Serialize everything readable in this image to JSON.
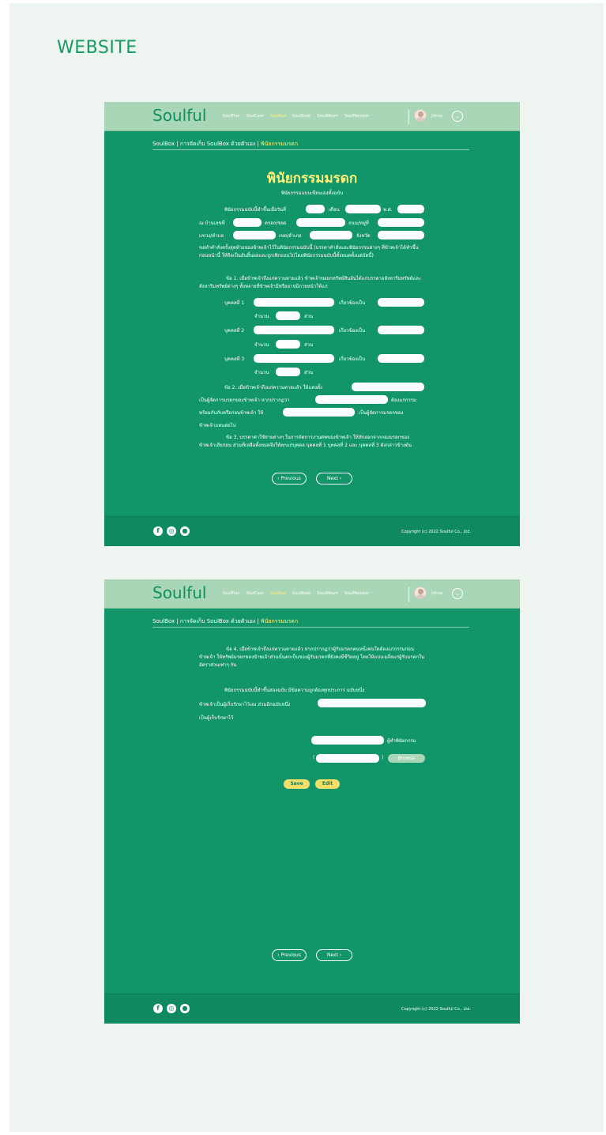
{
  "section_label": "WEBSITE",
  "nav": {
    "logo": "Soulful",
    "links": [
      "SoulPlan",
      "SoulCare",
      "SoulBox",
      "SoulBook",
      "SoulAlbum",
      "SoulMember"
    ],
    "active_link": "SoulBox",
    "user_name": "Jirime",
    "chevron": "⌄"
  },
  "breadcrumb": {
    "path": "SoulBox | การจัดเก็บ SoulBox ด้วยตัวเอง | ",
    "current": "พินัยกรรมมรดก"
  },
  "page1": {
    "title": "พินัยกรรมมรดก",
    "subtitle": "พินัยกรรมแบบเขียนเองทั้งฉบับ",
    "labels": {
      "intro": "พินัยกรรมฉบับนี้ทำขึ้นเมื่อวันที่",
      "month": "เดือน",
      "year": "พ.ศ.",
      "at_house": "ณ บ้านเลขที่",
      "soi": "ตรอก/ซอย",
      "moo": "ถนน/หมู่ที่",
      "tambon": "แขวง/ตำบล",
      "amphoe": "เขต/อำเภอ",
      "province": "จังหวัด"
    },
    "para_intro": "ขอทำคำสั่งครั้งสุดท้ายของข้าพเจ้าไว้ในพินัยกรรมฉบับนี้ (บรรดาคำสั่งและพินัยกรรมต่างๆ ที่ข้าพเจ้าได้ทำขึ้นก่อนหน้านี้ ให้ถือเป็นอันสิ้นผลและถูกเพิกถอนไปโดยพินัยกรรมฉบับนี้ทั้งหมดตั้งแต่บัดนี้)",
    "clause1": "ข้อ 1. เมื่อข้าพเจ้าถึงแก่ความตายแล้ว ข้าพเจ้าขอยกทรัพย์สินอันได้แก่บรรดาอสังหาริมทรัพย์และสังหาริมทรัพย์ต่างๆ ทั้งหลายที่ข้าพเจ้ามีหรืออาจมีภายหน้าให้แก่",
    "persons": [
      {
        "label": "บุคคลที่ 1",
        "relation": "เกี่ยวข้องเป็น",
        "amount": "จำนวน",
        "unit": "ส่วน"
      },
      {
        "label": "บุคคลที่ 2",
        "relation": "เกี่ยวข้องเป็น",
        "amount": "จำนวน",
        "unit": "ส่วน"
      },
      {
        "label": "บุคคลที่ 3",
        "relation": "เกี่ยวข้องเป็น",
        "amount": "จำนวน",
        "unit": "ส่วน"
      }
    ],
    "clause2_a": "ข้อ 2. เมื่อข้าพเจ้าถึงแก่ความตายแล้ว ให้แต่งตั้ง",
    "clause2_b": "เป็นผู้จัดการมรดกของข้าพเจ้า หากปรากฏว่า",
    "clause2_c": "ต้องแก่กรรม",
    "clause2_d": "พร้อมกันกับหรือก่อนข้าพเจ้า ให้",
    "clause2_e": "เป็นผู้จัดการมรดกของ",
    "clause2_f": "ข้าพเจ้าแทนต่อไป",
    "clause3": "ข้อ 3. บรรดาค่าใช้จ่ายต่างๆ ในการจัดการงานศพของข้าพเจ้า ให้หักออกจากกองมรดกของข้าพเจ้าเสียก่อน ส่วนที่เหลือทั้งหมดจึงให้ตกแก่บุคคล บุคคลที่ 1 บุคคลที่ 2 และ บุคคลที่ 3 ดังกล่าวข้างต้น",
    "prev": "‹ Previous",
    "next": "Next ›"
  },
  "page2": {
    "clause4": "ข้อ 4. เมื่อข้าพเจ้าถึงแก่ความตายแล้ว หากปรากฏว่าผู้รับมรดกคนหนึ่งคนใดต้องแก่กรรมก่อนข้าพเจ้า ให้ทรัพย์มรดกของข้าพเจ้าส่วนนั้นตกเป็นของผู้รับมรดกที่ยังคงมีชีวิตอยู่ โดยให้แบ่งเฉลี่ยแก่ผู้รับมรดกในอัตราส่วนเท่าๆ กัน",
    "closing_a": "พินัยกรรมฉบับนี้ทำขึ้นสองฉบับ มีข้อความถูกต้องทุกประการ ฉบับหนึ่ง",
    "closing_b": "ข้าพเจ้าเป็นผู้เก็บรักษาไว้เอง ส่วนอีกฉบับหนึ่ง",
    "closing_c": "เป็นผู้เก็บรักษาไว้",
    "testator": "ผู้ทำพินัยกรรม",
    "paren_open": "(",
    "paren_close": ")",
    "browse": "Browse",
    "save": "Save",
    "edit": "Edit",
    "prev": "‹ Previous",
    "next": "Next ›"
  },
  "footer": {
    "icons": [
      "facebook-icon",
      "instagram-icon",
      "line-icon"
    ],
    "copyright": "Copyright (c) 2022 Soulful Co., Ltd."
  }
}
